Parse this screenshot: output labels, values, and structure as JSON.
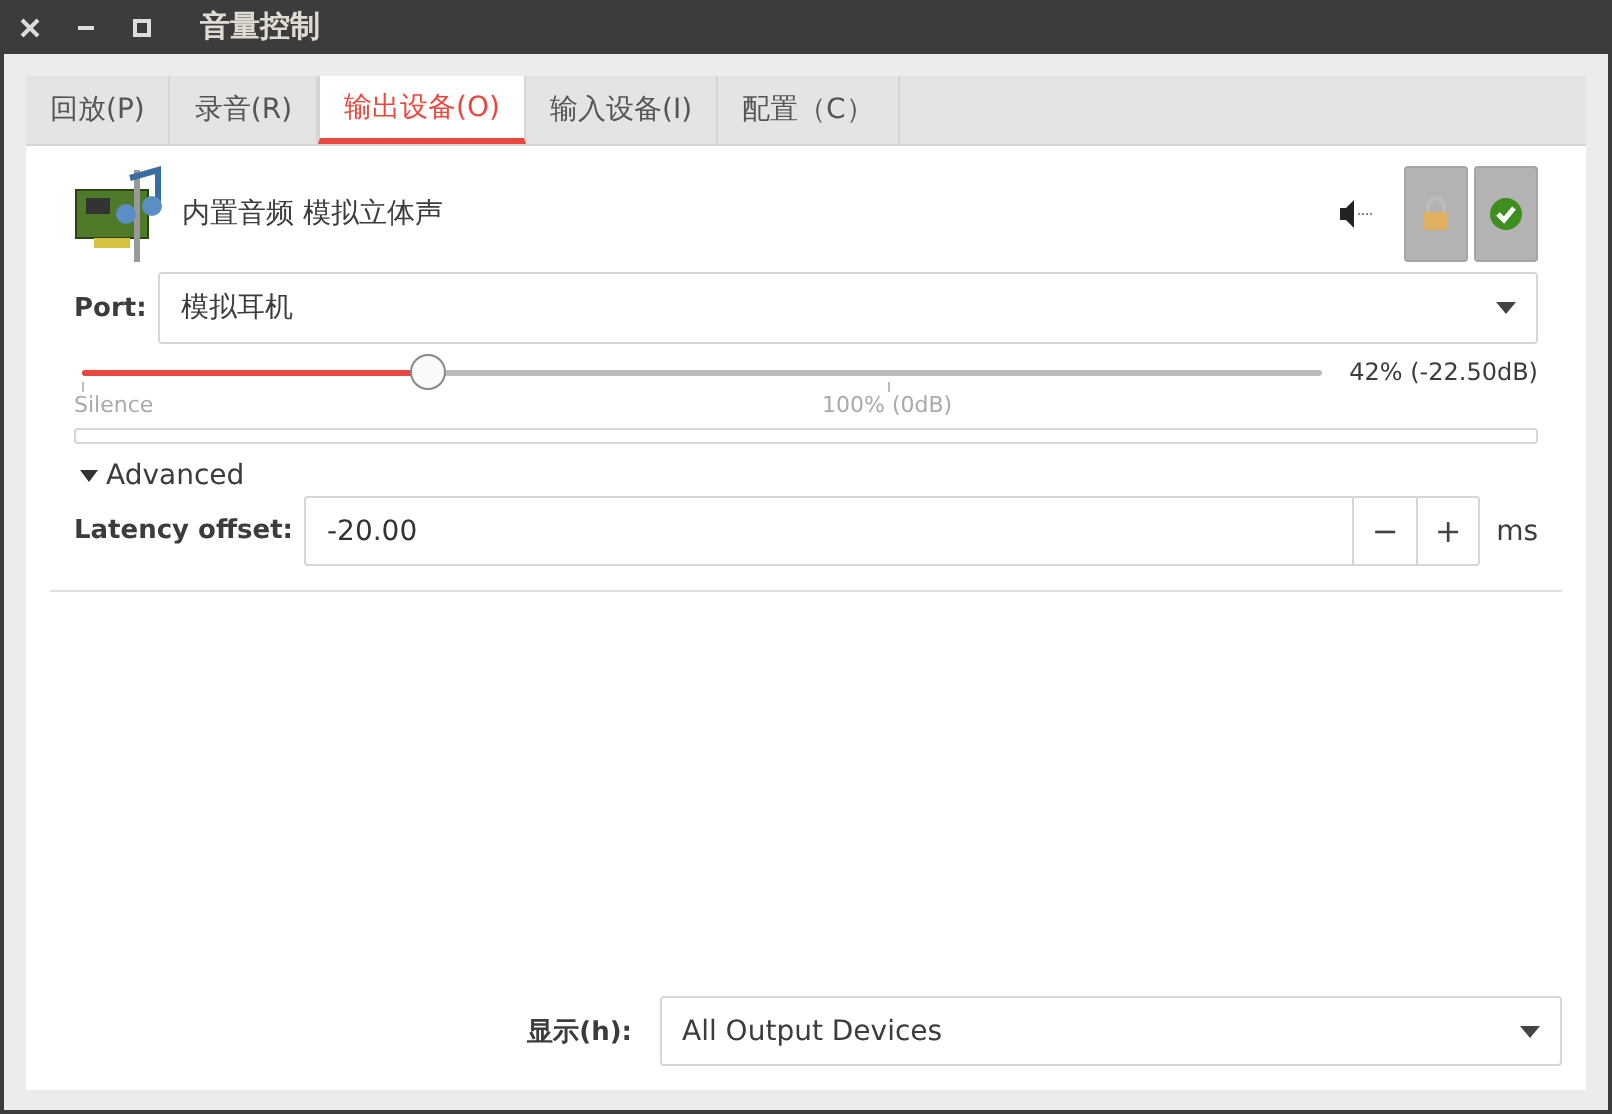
{
  "window": {
    "title": "音量控制"
  },
  "tabs": [
    {
      "label": "回放(P)",
      "selected": false
    },
    {
      "label": "录音(R)",
      "selected": false
    },
    {
      "label": "输出设备(O)",
      "selected": true
    },
    {
      "label": "输入设备(I)",
      "selected": false
    },
    {
      "label": "配置（C）",
      "selected": false
    }
  ],
  "device": {
    "name": "内置音频 模拟立体声",
    "locked": true,
    "default": true,
    "port": {
      "label": "Port:",
      "value": "模拟耳机"
    },
    "volume": {
      "level": 0.28,
      "reading": "42% (-22.50dB)",
      "marks": [
        "Silence",
        "100% (0dB)"
      ]
    },
    "meter": {
      "level": 0
    },
    "advanced": {
      "label": "Advanced",
      "expanded": true
    },
    "latency": {
      "label": "Latency offset:",
      "value": "-20.00",
      "decrement": "−",
      "increment": "+",
      "unit": "ms"
    }
  },
  "show": {
    "label": "显示(h):",
    "value": "All Output Devices"
  }
}
